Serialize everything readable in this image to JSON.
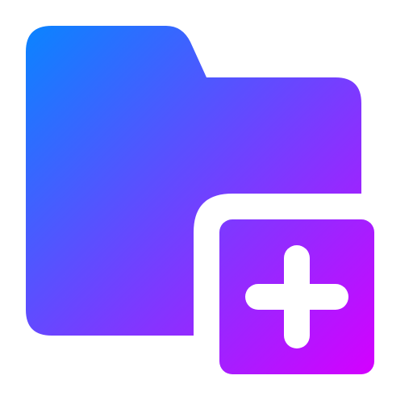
{
  "icon": {
    "name": "folder-add-icon",
    "gradient_start": "#0A84FF",
    "gradient_end": "#D400FF",
    "plus_color": "#FFFFFF",
    "background": "#FFFFFF"
  }
}
